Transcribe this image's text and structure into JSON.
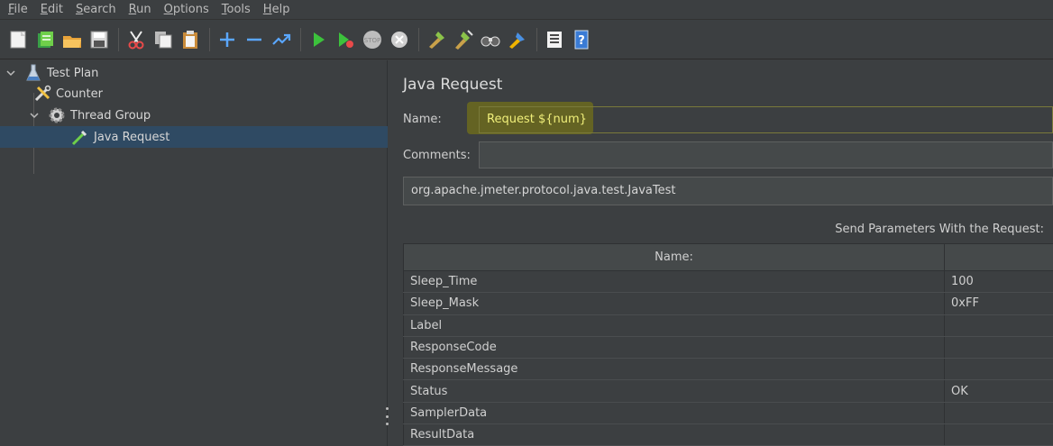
{
  "menubar": {
    "items": [
      {
        "prefix": "",
        "ul": "F",
        "rest": "ile"
      },
      {
        "prefix": "",
        "ul": "E",
        "rest": "dit"
      },
      {
        "prefix": "",
        "ul": "S",
        "rest": "earch"
      },
      {
        "prefix": "",
        "ul": "R",
        "rest": "un"
      },
      {
        "prefix": "",
        "ul": "O",
        "rest": "ptions"
      },
      {
        "prefix": "",
        "ul": "T",
        "rest": "ools"
      },
      {
        "prefix": "",
        "ul": "H",
        "rest": "elp"
      }
    ]
  },
  "toolbar": {
    "icons": [
      "new-icon",
      "templates-icon",
      "open-icon",
      "save-icon",
      "cut-icon",
      "copy-icon",
      "paste-icon",
      "expand-icon",
      "collapse-icon",
      "toggle-icon",
      "start-icon",
      "start-no-pause-icon",
      "stop-icon",
      "shutdown-icon",
      "clear-icon",
      "clear-all-icon",
      "search-icon",
      "reset-search-icon",
      "function-helper-icon",
      "help-icon"
    ]
  },
  "tree": {
    "nodes": [
      {
        "label": "Test Plan",
        "icon": "flask-icon"
      },
      {
        "label": "Counter",
        "icon": "tools-icon"
      },
      {
        "label": "Thread Group",
        "icon": "gear-icon"
      },
      {
        "label": "Java Request",
        "icon": "pipette-icon"
      }
    ]
  },
  "panel": {
    "title": "Java Request",
    "name_label": "Name:",
    "name_value": "Request ${num}",
    "comments_label": "Comments:",
    "comments_value": "",
    "classname_value": "org.apache.jmeter.protocol.java.test.JavaTest",
    "send_params_label": "Send Parameters With the Request:",
    "table": {
      "headers": [
        "Name:",
        ""
      ],
      "rows": [
        [
          "Sleep_Time",
          "100"
        ],
        [
          "Sleep_Mask",
          "0xFF"
        ],
        [
          "Label",
          ""
        ],
        [
          "ResponseCode",
          ""
        ],
        [
          "ResponseMessage",
          ""
        ],
        [
          "Status",
          "OK"
        ],
        [
          "SamplerData",
          ""
        ],
        [
          "ResultData",
          ""
        ]
      ]
    }
  },
  "colors": {
    "background": "#3c3f41",
    "selection": "#2f4a63",
    "name_highlight": "#6b6a1e",
    "name_text": "#f0ef7a"
  }
}
